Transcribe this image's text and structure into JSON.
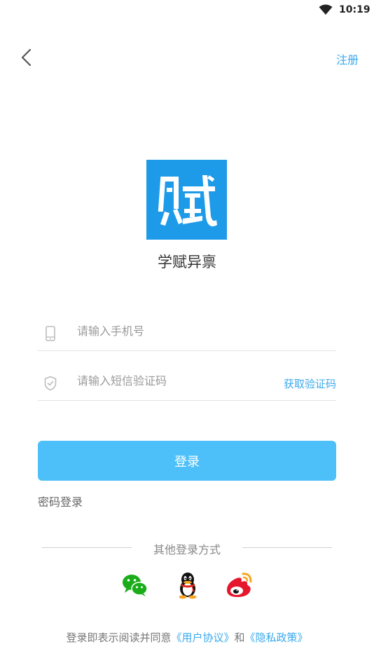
{
  "status_bar": {
    "time": "10:19"
  },
  "header": {
    "register_label": "注册"
  },
  "app": {
    "logo_char": "赋",
    "name": "学赋异禀"
  },
  "form": {
    "phone_placeholder": "请输入手机号",
    "code_placeholder": "请输入短信验证码",
    "get_code_label": "获取验证码",
    "login_label": "登录",
    "password_login_label": "密码登录"
  },
  "other_login": {
    "title": "其他登录方式",
    "methods": [
      "wechat-icon",
      "qq-icon",
      "weibo-icon"
    ]
  },
  "agreement": {
    "prefix": "登录即表示阅读并同意",
    "user_agreement": "《用户协议》",
    "and": "和",
    "privacy_policy": "《隐私政策》"
  },
  "colors": {
    "accent": "#3aa9ec",
    "button": "#4ec0f9",
    "logo_bg": "#1e9be8"
  }
}
